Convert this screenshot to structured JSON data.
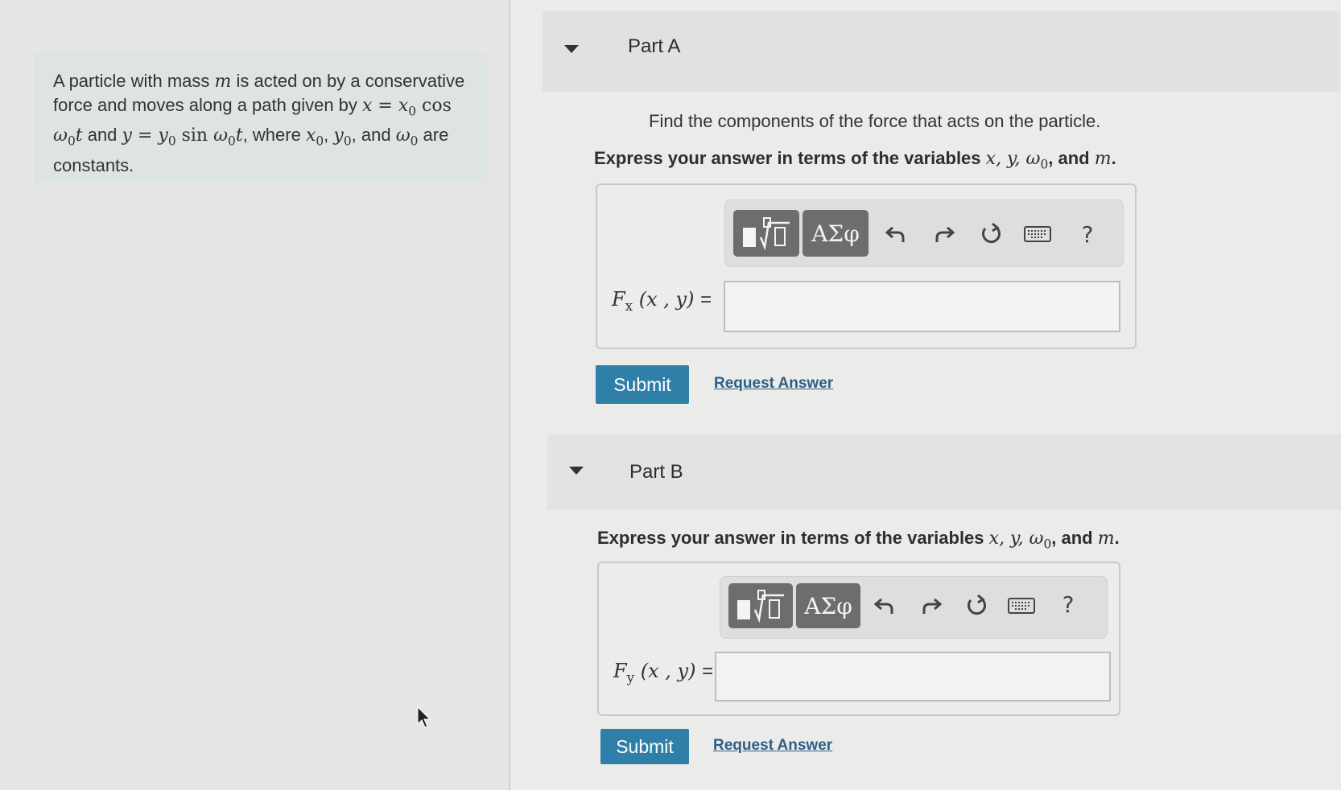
{
  "problem": {
    "text_1": "A particle with mass ",
    "m": "m",
    "text_2": " is acted on by a conservative force and moves along a path given by ",
    "x_eq": "x = x",
    "x_sub": "0",
    "cos": " cos ",
    "w": "ω",
    "w_sub": "0",
    "t": "t",
    "and": " and ",
    "y_eq": "y = y",
    "y_sub": "0",
    "sin": " sin ",
    "where": ", where ",
    "x0": "x",
    "y0": "y",
    "comma": ", ",
    "and2": ", and ",
    "w0": "ω",
    "end": " are constants."
  },
  "part_a": {
    "title": "Part A",
    "question": "Find the components of the force that acts on the particle.",
    "express_prefix": "Express your answer in terms of the variables ",
    "vars": "x, y, ω",
    "vars_sub": "0",
    "express_and": ", and ",
    "var_m": "m",
    "express_end": ".",
    "label_f": "F",
    "label_sub": "x",
    "label_args": " (x , y) ",
    "label_eq": "=",
    "input_value": "",
    "submit": "Submit",
    "request": "Request Answer"
  },
  "part_b": {
    "title": "Part B",
    "express_prefix": "Express your answer in terms of the variables ",
    "vars": "x, y, ω",
    "vars_sub": "0",
    "express_and": ", and ",
    "var_m": "m",
    "express_end": ".",
    "label_f": "F",
    "label_sub": "y",
    "label_args": " (x , y) ",
    "label_eq": "=",
    "input_value": "",
    "submit": "Submit",
    "request": "Request Answer"
  },
  "toolbar": {
    "greek": "ΑΣφ",
    "help": "?",
    "icons": [
      "templates-icon",
      "greek-letters-icon",
      "undo-icon",
      "redo-icon",
      "reset-icon",
      "keyboard-icon",
      "help-icon"
    ]
  }
}
